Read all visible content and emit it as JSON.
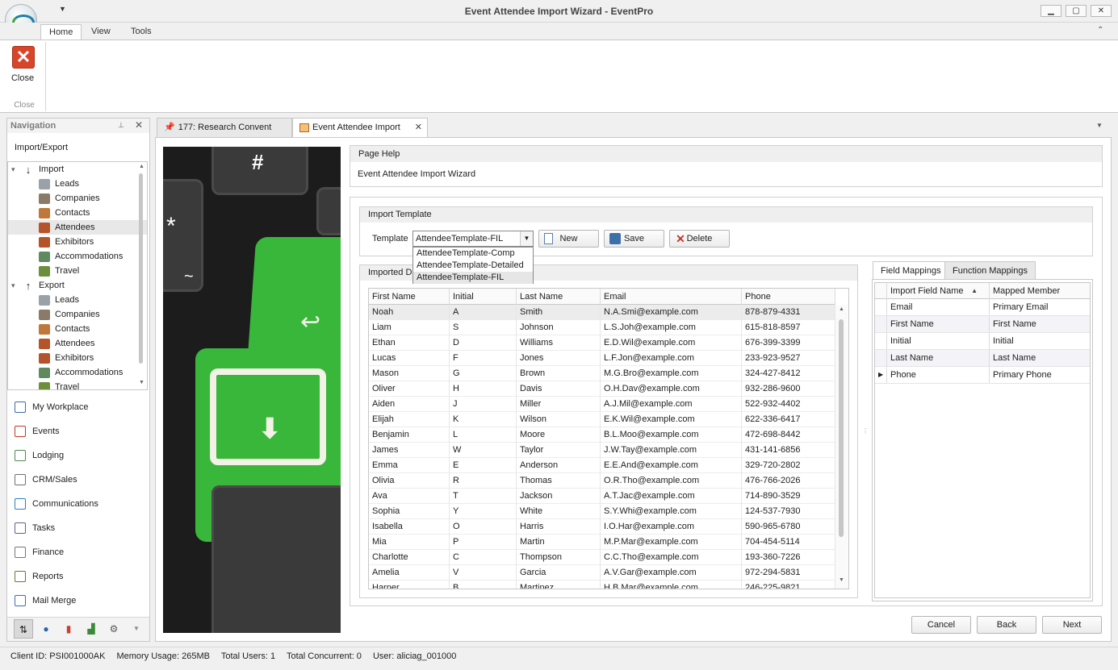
{
  "window": {
    "title": "Event Attendee Import Wizard - EventPro",
    "controls": {
      "minimize": "▁",
      "maximize": "▢",
      "close": "✕"
    }
  },
  "ribbon": {
    "tabs": [
      "Home",
      "View",
      "Tools"
    ],
    "active_tab": "Home",
    "close_button_label": "Close",
    "group_label": "Close"
  },
  "navigation": {
    "header": "Navigation",
    "subheader": "Import/Export",
    "tree": [
      {
        "label": "Import",
        "level": 0,
        "icon": "arrow-down-icon",
        "expanded": true
      },
      {
        "label": "Leads",
        "level": 1,
        "icon": "person-icon"
      },
      {
        "label": "Companies",
        "level": 1,
        "icon": "building-icon"
      },
      {
        "label": "Contacts",
        "level": 1,
        "icon": "contact-icon"
      },
      {
        "label": "Attendees",
        "level": 1,
        "icon": "attendee-icon",
        "selected": true
      },
      {
        "label": "Exhibitors",
        "level": 1,
        "icon": "exhibitor-icon"
      },
      {
        "label": "Accommodations",
        "level": 1,
        "icon": "accommodation-icon"
      },
      {
        "label": "Travel",
        "level": 1,
        "icon": "plane-icon"
      },
      {
        "label": "Export",
        "level": 0,
        "icon": "arrow-up-icon",
        "expanded": true
      },
      {
        "label": "Leads",
        "level": 1,
        "icon": "person-icon"
      },
      {
        "label": "Companies",
        "level": 1,
        "icon": "building-icon"
      },
      {
        "label": "Contacts",
        "level": 1,
        "icon": "contact-icon"
      },
      {
        "label": "Attendees",
        "level": 1,
        "icon": "attendee-icon"
      },
      {
        "label": "Exhibitors",
        "level": 1,
        "icon": "exhibitor-icon"
      },
      {
        "label": "Accommodations",
        "level": 1,
        "icon": "accommodation-icon"
      },
      {
        "label": "Travel",
        "level": 1,
        "icon": "plane-icon"
      }
    ],
    "links": [
      {
        "label": "My Workplace",
        "icon": "house-icon"
      },
      {
        "label": "Events",
        "icon": "pushpin-icon"
      },
      {
        "label": "Lodging",
        "icon": "lodging-icon"
      },
      {
        "label": "CRM/Sales",
        "icon": "crm-icon"
      },
      {
        "label": "Communications",
        "icon": "speech-bubble-icon"
      },
      {
        "label": "Tasks",
        "icon": "clipboard-icon"
      },
      {
        "label": "Finance",
        "icon": "calculator-icon"
      },
      {
        "label": "Reports",
        "icon": "report-icon"
      },
      {
        "label": "Mail Merge",
        "icon": "mail-merge-icon"
      }
    ]
  },
  "doc_tabs": [
    {
      "label": "177: Research Convent",
      "icon": "pushpin-icon"
    },
    {
      "label": "Event Attendee Import",
      "icon": "import-icon",
      "active": true
    }
  ],
  "page_help": {
    "header": "Page Help",
    "text": "Event Attendee Import Wizard"
  },
  "import_template": {
    "header": "Import Template",
    "label": "Template",
    "selected": "AttendeeTemplate-FIL",
    "options": [
      "AttendeeTemplate-Comp",
      "AttendeeTemplate-Detailed",
      "AttendeeTemplate-FIL"
    ],
    "buttons": {
      "new": "New",
      "save": "Save",
      "delete": "Delete"
    }
  },
  "imported_data": {
    "header": "Imported D",
    "columns": [
      "First Name",
      "Initial",
      "Last Name",
      "Email",
      "Phone"
    ],
    "rows": [
      [
        "Noah",
        "A",
        "Smith",
        "N.A.Smi@example.com",
        "878-879-4331"
      ],
      [
        "Liam",
        "S",
        "Johnson",
        "L.S.Joh@example.com",
        "615-818-8597"
      ],
      [
        "Ethan",
        "D",
        "Williams",
        "E.D.Wil@example.com",
        "676-399-3399"
      ],
      [
        "Lucas",
        "F",
        "Jones",
        "L.F.Jon@example.com",
        "233-923-9527"
      ],
      [
        "Mason",
        "G",
        "Brown",
        "M.G.Bro@example.com",
        "324-427-8412"
      ],
      [
        "Oliver",
        "H",
        "Davis",
        "O.H.Dav@example.com",
        "932-286-9600"
      ],
      [
        "Aiden",
        "J",
        "Miller",
        "A.J.Mil@example.com",
        "522-932-4402"
      ],
      [
        "Elijah",
        "K",
        "Wilson",
        "E.K.Wil@example.com",
        "622-336-6417"
      ],
      [
        "Benjamin",
        "L",
        "Moore",
        "B.L.Moo@example.com",
        "472-698-8442"
      ],
      [
        "James",
        "W",
        "Taylor",
        "J.W.Tay@example.com",
        "431-141-6856"
      ],
      [
        "Emma",
        "E",
        "Anderson",
        "E.E.And@example.com",
        "329-720-2802"
      ],
      [
        "Olivia",
        "R",
        "Thomas",
        "O.R.Tho@example.com",
        "476-766-2026"
      ],
      [
        "Ava",
        "T",
        "Jackson",
        "A.T.Jac@example.com",
        "714-890-3529"
      ],
      [
        "Sophia",
        "Y",
        "White",
        "S.Y.Whi@example.com",
        "124-537-7930"
      ],
      [
        "Isabella",
        "O",
        "Harris",
        "I.O.Har@example.com",
        "590-965-6780"
      ],
      [
        "Mia",
        "P",
        "Martin",
        "M.P.Mar@example.com",
        "704-454-5114"
      ],
      [
        "Charlotte",
        "C",
        "Thompson",
        "C.C.Tho@example.com",
        "193-360-7226"
      ],
      [
        "Amelia",
        "V",
        "Garcia",
        "A.V.Gar@example.com",
        "972-294-5831"
      ],
      [
        "Harper",
        "B",
        "Martinez",
        "H.B.Mar@example.com",
        "246-225-9821"
      ]
    ]
  },
  "mappings": {
    "tabs": [
      "Field Mappings",
      "Function Mappings"
    ],
    "active_tab": "Field Mappings",
    "columns": [
      "Import Field Name",
      "Mapped Member"
    ],
    "sort_indicator": "▲",
    "rows": [
      [
        "Email",
        "Primary Email"
      ],
      [
        "First Name",
        "First Name"
      ],
      [
        "Initial",
        "Initial"
      ],
      [
        "Last Name",
        "Last Name"
      ],
      [
        "Phone",
        "Primary Phone"
      ]
    ],
    "current_row": 4
  },
  "wizard_buttons": {
    "cancel": "Cancel",
    "back": "Back",
    "next": "Next"
  },
  "status": {
    "client_id": "Client ID: PSI001000AK",
    "memory": "Memory Usage: 265MB",
    "total_users": "Total Users: 1",
    "total_concurrent": "Total Concurrent: 0",
    "user": "User: aliciag_001000"
  },
  "colors": {
    "accent_green": "#38b73a",
    "close_red": "#d9452b",
    "selection": "#e8e8e8"
  }
}
